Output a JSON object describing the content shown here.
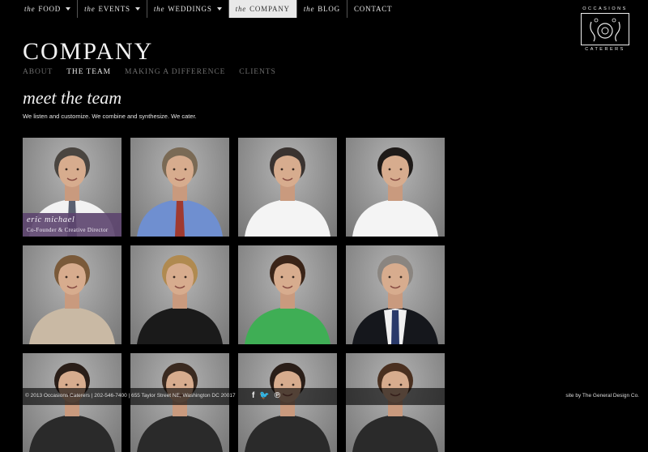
{
  "nav": [
    {
      "prefix": "the",
      "label": "FOOD",
      "has_dropdown": true,
      "active": false
    },
    {
      "prefix": "the",
      "label": "EVENTS",
      "has_dropdown": true,
      "active": false
    },
    {
      "prefix": "the",
      "label": "WEDDINGS",
      "has_dropdown": true,
      "active": false
    },
    {
      "prefix": "the",
      "label": "COMPANY",
      "has_dropdown": false,
      "active": true
    },
    {
      "prefix": "the",
      "label": "BLOG",
      "has_dropdown": false,
      "active": false
    },
    {
      "prefix": "",
      "label": "CONTACT",
      "has_dropdown": false,
      "active": false
    }
  ],
  "logo": {
    "top": "OCCASIONS",
    "bottom": "CATERERS"
  },
  "page": {
    "title": "COMPANY"
  },
  "subnav": [
    {
      "label": "ABOUT",
      "active": false
    },
    {
      "label": "THE TEAM",
      "active": true
    },
    {
      "label": "MAKING A DIFFERENCE",
      "active": false
    },
    {
      "label": "CLIENTS",
      "active": false
    }
  ],
  "team": {
    "heading": "meet the team",
    "intro": "We listen and customize. We combine and synthesize. We cater.",
    "members": [
      {
        "name": "eric michael",
        "role": "Co-Founder & Creative Director",
        "attire": "dress-shirt",
        "tie": "#5a6070",
        "hair": "#4a4540",
        "hovered": true
      },
      {
        "attire": "blue-shirt",
        "tie": "#a03a30",
        "hair": "#7a6a55"
      },
      {
        "attire": "chef-coat",
        "hair": "#3a3330"
      },
      {
        "attire": "chef-coat",
        "hair": "#1e1a18"
      },
      {
        "attire": "beige-top",
        "hair": "#7a5a3a"
      },
      {
        "attire": "black-top",
        "hair": "#b08a50"
      },
      {
        "attire": "green-top",
        "hair": "#3a2418"
      },
      {
        "attire": "dark-suit",
        "tie": "#2a3a6a",
        "hair": "#8a8580"
      },
      {
        "attire": "dark-top",
        "hair": "#2a1e18"
      },
      {
        "attire": "dark-top",
        "hair": "#3a2a20"
      },
      {
        "attire": "dark-top",
        "hair": "#2a1e18"
      },
      {
        "attire": "dark-top",
        "hair": "#4a3020"
      }
    ]
  },
  "footer": {
    "copyright": "© 2013 Occasions Caterers | 202-546-7400 | 655 Taylor Street NE, Washington DC 20017",
    "social": [
      "f",
      "twitter",
      "p"
    ],
    "social_glyphs": [
      "f",
      "🐦",
      "℗"
    ],
    "credit": "site by The General Design Co."
  }
}
